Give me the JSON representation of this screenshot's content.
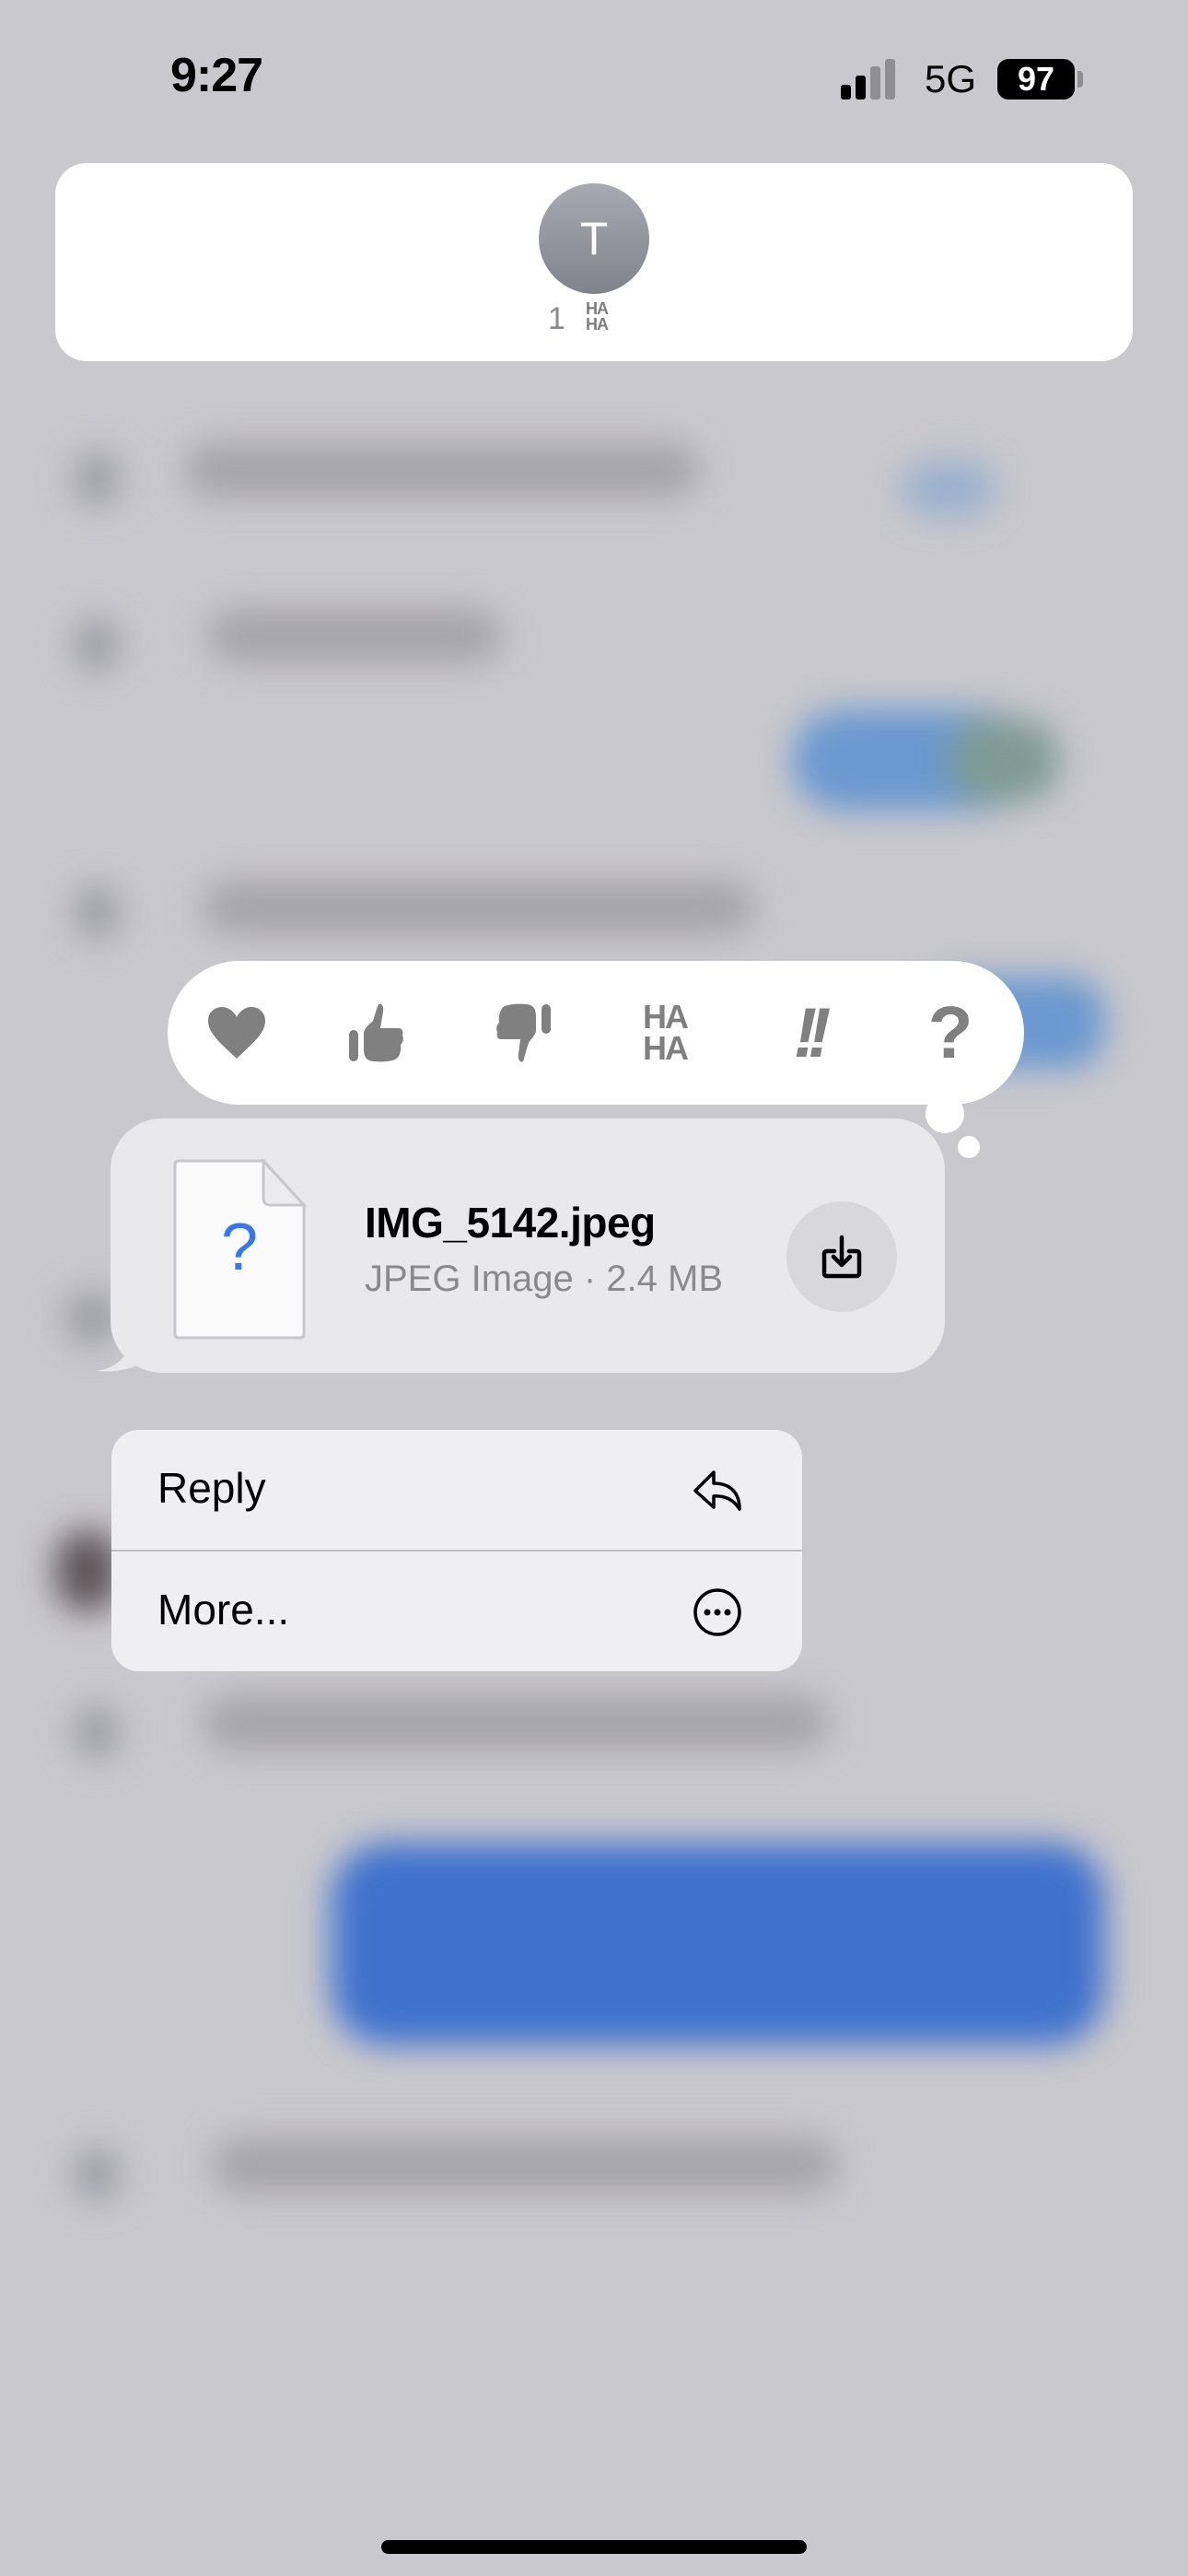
{
  "status_bar": {
    "time": "9:27",
    "network": "5G",
    "battery_level": "97",
    "signal_bars_active": 2,
    "signal_bars_total": 4
  },
  "reactions_summary": {
    "avatar_initial": "T",
    "reaction_count": "1",
    "reaction_label": "HA HA",
    "reaction_line1": "HA",
    "reaction_line2": "HA"
  },
  "tapbacks": [
    {
      "name": "heart",
      "icon": "heart-icon"
    },
    {
      "name": "thumbs-up",
      "icon": "thumbs-up-icon"
    },
    {
      "name": "thumbs-down",
      "icon": "thumbs-down-icon"
    },
    {
      "name": "haha",
      "icon": "haha-icon",
      "line1": "HA",
      "line2": "HA"
    },
    {
      "name": "emphasize",
      "icon": "double-exclamation-icon",
      "glyph": "!!"
    },
    {
      "name": "question",
      "icon": "question-mark-icon",
      "glyph": "?"
    }
  ],
  "file_message": {
    "file_name": "IMG_5142.jpeg",
    "file_meta": "JPEG Image · 2.4 MB",
    "file_icon_glyph": "?",
    "download_icon": "download-icon"
  },
  "context_menu": {
    "items": [
      {
        "label": "Reply",
        "icon": "reply-arrow-icon"
      },
      {
        "label": "More...",
        "icon": "ellipsis-circle-icon"
      }
    ]
  },
  "colors": {
    "background": "#c9c8cd",
    "bubble_gray": "#e9e9eb",
    "tapback_glyph": "#808080",
    "accent_blue": "#3478f6"
  }
}
